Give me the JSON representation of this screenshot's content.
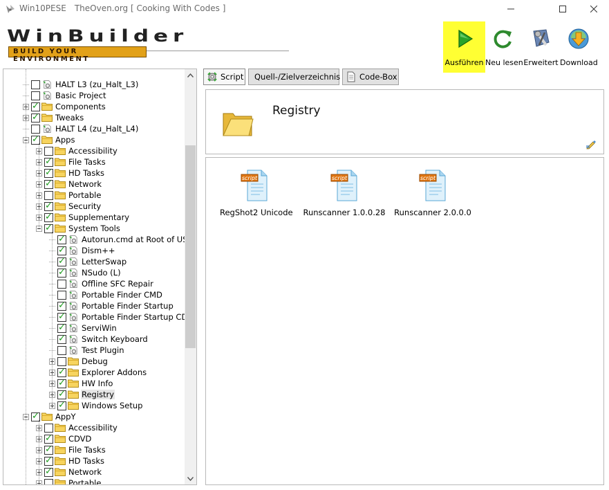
{
  "window": {
    "app_name": "Win10PESE",
    "subtitle": "TheOven.org [ Cooking With Codes ]",
    "icons": [
      "app-icon",
      "minimize-icon",
      "maximize-icon",
      "close-icon"
    ]
  },
  "logo": {
    "title": "WinBuilder",
    "tagline": "BUILD YOUR ENVIRONMENT"
  },
  "toolbar": {
    "run_label": "Ausführen",
    "refresh_label": "Neu lesen",
    "advanced_label": "Erweitert",
    "download_label": "Download",
    "run_highlight_color": "#ffff33"
  },
  "tabs": [
    {
      "label": "Script",
      "icon": "gear-script-icon",
      "active": true
    },
    {
      "label": "Quell-/Zielverzeichnis",
      "icon": "folder-icon",
      "active": false
    },
    {
      "label": "Code-Box",
      "icon": "page-icon",
      "active": false
    }
  ],
  "directory": {
    "title": "Registry"
  },
  "files": [
    {
      "label": "RegShot2 Unicode",
      "badge": "script"
    },
    {
      "label": "Runscanner 1.0.0.28",
      "badge": "script"
    },
    {
      "label": "Runscanner 2.0.0.0",
      "badge": "script"
    }
  ],
  "tree": [
    {
      "label": "HALT L3 (zu_Halt_L3)",
      "type": "script",
      "level": 0,
      "expander": "none",
      "checked": false
    },
    {
      "label": "Basic Project",
      "type": "script",
      "level": 0,
      "expander": "none",
      "checked": false
    },
    {
      "label": "Components",
      "type": "folder",
      "level": 0,
      "expander": "plus",
      "checked": true
    },
    {
      "label": "Tweaks",
      "type": "folder",
      "level": 0,
      "expander": "plus",
      "checked": true
    },
    {
      "label": "HALT L4 (zu_Halt_L4)",
      "type": "script",
      "level": 0,
      "expander": "none",
      "checked": false
    },
    {
      "label": "Apps",
      "type": "folder",
      "level": 0,
      "expander": "minus",
      "checked": true
    },
    {
      "label": "Accessibility",
      "type": "folder",
      "level": 1,
      "expander": "plus",
      "checked": false
    },
    {
      "label": "File Tasks",
      "type": "folder",
      "level": 1,
      "expander": "plus",
      "checked": true
    },
    {
      "label": "HD Tasks",
      "type": "folder",
      "level": 1,
      "expander": "plus",
      "checked": true
    },
    {
      "label": "Network",
      "type": "folder",
      "level": 1,
      "expander": "plus",
      "checked": true
    },
    {
      "label": "Portable",
      "type": "folder",
      "level": 1,
      "expander": "plus",
      "checked": false
    },
    {
      "label": "Security",
      "type": "folder",
      "level": 1,
      "expander": "plus",
      "checked": true
    },
    {
      "label": "Supplementary",
      "type": "folder",
      "level": 1,
      "expander": "plus",
      "checked": true
    },
    {
      "label": "System Tools",
      "type": "folder",
      "level": 1,
      "expander": "minus",
      "checked": true
    },
    {
      "label": "Autorun.cmd at Root of USB",
      "type": "script",
      "level": 2,
      "expander": "none",
      "checked": true
    },
    {
      "label": "Dism++",
      "type": "script",
      "level": 2,
      "expander": "none",
      "checked": true
    },
    {
      "label": "LetterSwap",
      "type": "script",
      "level": 2,
      "expander": "none",
      "checked": true
    },
    {
      "label": "NSudo (L)",
      "type": "script",
      "level": 2,
      "expander": "none",
      "checked": true
    },
    {
      "label": "Offline SFC Repair",
      "type": "script",
      "level": 2,
      "expander": "none",
      "checked": false
    },
    {
      "label": "Portable Finder CMD",
      "type": "script",
      "level": 2,
      "expander": "none",
      "checked": false
    },
    {
      "label": "Portable Finder Startup",
      "type": "script",
      "level": 2,
      "expander": "none",
      "checked": true
    },
    {
      "label": "Portable Finder Startup CD",
      "type": "script",
      "level": 2,
      "expander": "none",
      "checked": true
    },
    {
      "label": "ServiWin",
      "type": "script",
      "level": 2,
      "expander": "none",
      "checked": true
    },
    {
      "label": "Switch Keyboard",
      "type": "script",
      "level": 2,
      "expander": "none",
      "checked": true
    },
    {
      "label": "Test Plugin",
      "type": "script",
      "level": 2,
      "expander": "none",
      "checked": false
    },
    {
      "label": "Debug",
      "type": "folder",
      "level": 2,
      "expander": "plus",
      "checked": false
    },
    {
      "label": "Explorer Addons",
      "type": "folder",
      "level": 2,
      "expander": "plus",
      "checked": true
    },
    {
      "label": "HW Info",
      "type": "folder",
      "level": 2,
      "expander": "plus",
      "checked": true
    },
    {
      "label": "Registry",
      "type": "folder",
      "level": 2,
      "expander": "plus",
      "checked": true,
      "selected": true
    },
    {
      "label": "Windows Setup",
      "type": "folder",
      "level": 2,
      "expander": "plus",
      "checked": true
    },
    {
      "label": "AppY",
      "type": "folder",
      "level": 0,
      "expander": "minus",
      "checked": true
    },
    {
      "label": "Accessibility",
      "type": "folder",
      "level": 1,
      "expander": "plus",
      "checked": false
    },
    {
      "label": "CDVD",
      "type": "folder",
      "level": 1,
      "expander": "plus",
      "checked": true
    },
    {
      "label": "File Tasks",
      "type": "folder",
      "level": 1,
      "expander": "plus",
      "checked": true
    },
    {
      "label": "HD Tasks",
      "type": "folder",
      "level": 1,
      "expander": "plus",
      "checked": true
    },
    {
      "label": "Network",
      "type": "folder",
      "level": 1,
      "expander": "plus",
      "checked": true
    },
    {
      "label": "Portable",
      "type": "folder",
      "level": 1,
      "expander": "plus",
      "checked": false
    }
  ]
}
